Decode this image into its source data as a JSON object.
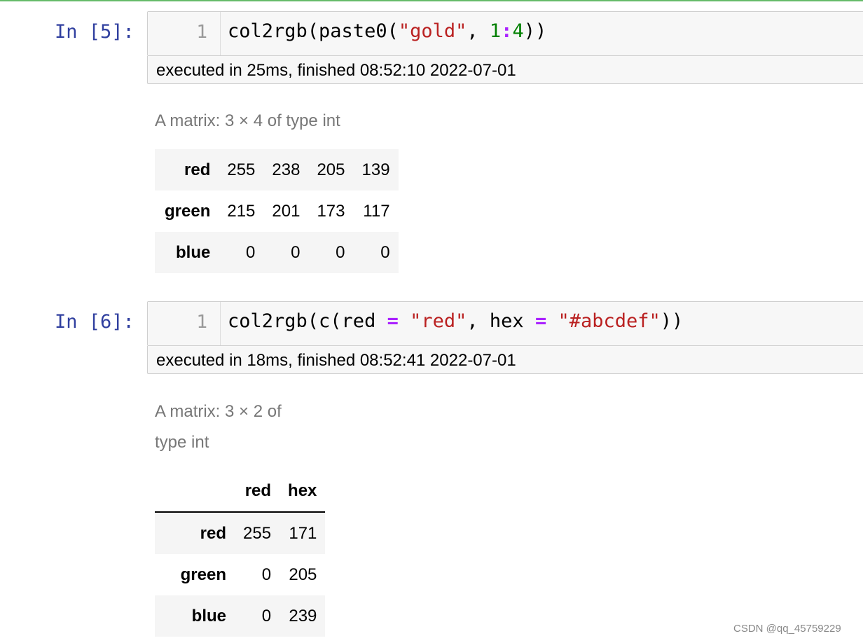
{
  "cells": [
    {
      "prompt": "In [5]:",
      "line_number": "1",
      "code_tokens": [
        {
          "text": "col2rgb(paste0(",
          "kind": "plain"
        },
        {
          "text": "\"gold\"",
          "kind": "str"
        },
        {
          "text": ", ",
          "kind": "plain"
        },
        {
          "text": "1",
          "kind": "num"
        },
        {
          "text": ":",
          "kind": "op"
        },
        {
          "text": "4",
          "kind": "num"
        },
        {
          "text": "))",
          "kind": "plain"
        }
      ],
      "execution_info": "executed in 25ms, finished 08:52:10 2022-07-01",
      "output": {
        "caption_lines": [
          "A matrix: 3 × 4 of type int"
        ],
        "column_headers": [],
        "rows": [
          {
            "label": "red",
            "values": [
              "255",
              "238",
              "205",
              "139"
            ]
          },
          {
            "label": "green",
            "values": [
              "215",
              "201",
              "173",
              "117"
            ]
          },
          {
            "label": "blue",
            "values": [
              "0",
              "0",
              "0",
              "0"
            ]
          }
        ]
      }
    },
    {
      "prompt": "In [6]:",
      "line_number": "1",
      "code_tokens": [
        {
          "text": "col2rgb(c(red ",
          "kind": "plain"
        },
        {
          "text": "=",
          "kind": "op"
        },
        {
          "text": " ",
          "kind": "plain"
        },
        {
          "text": "\"red\"",
          "kind": "str"
        },
        {
          "text": ", hex ",
          "kind": "plain"
        },
        {
          "text": "=",
          "kind": "op"
        },
        {
          "text": " ",
          "kind": "plain"
        },
        {
          "text": "\"#abcdef\"",
          "kind": "str"
        },
        {
          "text": "))",
          "kind": "plain"
        }
      ],
      "execution_info": "executed in 18ms, finished 08:52:41 2022-07-01",
      "output": {
        "caption_lines": [
          "A matrix: 3 × 2 of",
          "type int"
        ],
        "column_headers": [
          "red",
          "hex"
        ],
        "rows": [
          {
            "label": "red",
            "values": [
              "255",
              "171"
            ]
          },
          {
            "label": "green",
            "values": [
              "0",
              "205"
            ]
          },
          {
            "label": "blue",
            "values": [
              "0",
              "239"
            ]
          }
        ]
      }
    }
  ],
  "watermark": "CSDN @qq_45759229",
  "colors": {
    "prompt": "#303f9f",
    "string": "#ba2121",
    "number": "#008000",
    "operator": "#aa22ff",
    "selected_cell_rule": "#66bb6a"
  }
}
